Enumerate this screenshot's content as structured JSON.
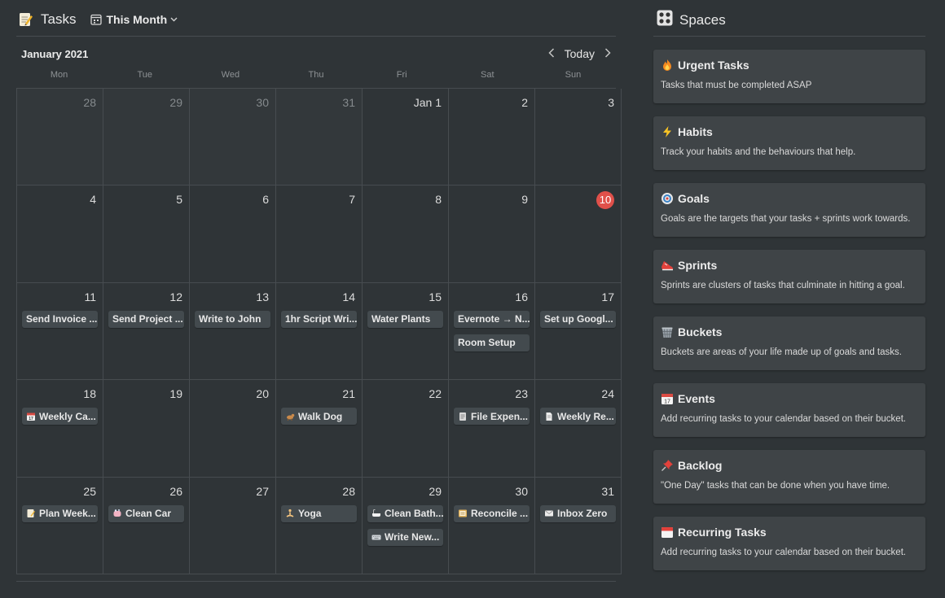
{
  "header": {
    "title": "Tasks",
    "icon": "memo-icon",
    "view_label": "This Month"
  },
  "calendar": {
    "month_title": "January 2021",
    "today_label": "Today",
    "weekdays": [
      "Mon",
      "Tue",
      "Wed",
      "Thu",
      "Fri",
      "Sat",
      "Sun"
    ],
    "today_date": "10",
    "days": [
      {
        "label": "28",
        "muted": true,
        "tasks": []
      },
      {
        "label": "29",
        "muted": true,
        "tasks": []
      },
      {
        "label": "30",
        "muted": true,
        "tasks": []
      },
      {
        "label": "31",
        "muted": true,
        "tasks": []
      },
      {
        "label": "Jan 1",
        "muted": false,
        "tasks": []
      },
      {
        "label": "2",
        "muted": false,
        "tasks": []
      },
      {
        "label": "3",
        "muted": false,
        "tasks": []
      },
      {
        "label": "4",
        "muted": false,
        "tasks": []
      },
      {
        "label": "5",
        "muted": false,
        "tasks": []
      },
      {
        "label": "6",
        "muted": false,
        "tasks": []
      },
      {
        "label": "7",
        "muted": false,
        "tasks": []
      },
      {
        "label": "8",
        "muted": false,
        "tasks": []
      },
      {
        "label": "9",
        "muted": false,
        "tasks": []
      },
      {
        "label": "10",
        "muted": false,
        "today": true,
        "tasks": []
      },
      {
        "label": "11",
        "muted": false,
        "tasks": [
          {
            "text": "Send Invoice ..."
          }
        ]
      },
      {
        "label": "12",
        "muted": false,
        "tasks": [
          {
            "text": "Send Project ..."
          }
        ]
      },
      {
        "label": "13",
        "muted": false,
        "tasks": [
          {
            "text": "Write to John"
          }
        ]
      },
      {
        "label": "14",
        "muted": false,
        "tasks": [
          {
            "text": "1hr Script Wri..."
          }
        ]
      },
      {
        "label": "15",
        "muted": false,
        "tasks": [
          {
            "text": "Water Plants"
          }
        ]
      },
      {
        "label": "16",
        "muted": false,
        "tasks": [
          {
            "text": "Evernote → N..."
          },
          {
            "text": "Room Setup"
          }
        ]
      },
      {
        "label": "17",
        "muted": false,
        "tasks": [
          {
            "text": "Set up Googl..."
          }
        ]
      },
      {
        "label": "18",
        "muted": false,
        "tasks": [
          {
            "text": "Weekly Ca...",
            "icon": "calendar-icon"
          }
        ]
      },
      {
        "label": "19",
        "muted": false,
        "tasks": []
      },
      {
        "label": "20",
        "muted": false,
        "tasks": []
      },
      {
        "label": "21",
        "muted": false,
        "tasks": [
          {
            "text": "Walk Dog",
            "icon": "dog-icon"
          }
        ]
      },
      {
        "label": "22",
        "muted": false,
        "tasks": []
      },
      {
        "label": "23",
        "muted": false,
        "tasks": [
          {
            "text": "File Expen...",
            "icon": "document-icon"
          }
        ]
      },
      {
        "label": "24",
        "muted": false,
        "tasks": [
          {
            "text": "Weekly Re...",
            "icon": "page-icon"
          }
        ]
      },
      {
        "label": "25",
        "muted": false,
        "tasks": [
          {
            "text": "Plan Week...",
            "icon": "memo-icon"
          }
        ]
      },
      {
        "label": "26",
        "muted": false,
        "tasks": [
          {
            "text": "Clean Car",
            "icon": "soap-icon"
          }
        ]
      },
      {
        "label": "27",
        "muted": false,
        "tasks": []
      },
      {
        "label": "28",
        "muted": false,
        "tasks": [
          {
            "text": "Yoga",
            "icon": "yoga-icon"
          }
        ]
      },
      {
        "label": "29",
        "muted": false,
        "tasks": [
          {
            "text": "Clean Bath...",
            "icon": "bathtub-icon"
          },
          {
            "text": "Write New...",
            "icon": "keyboard-icon"
          }
        ]
      },
      {
        "label": "30",
        "muted": false,
        "tasks": [
          {
            "text": "Reconcile ...",
            "icon": "ledger-icon"
          }
        ]
      },
      {
        "label": "31",
        "muted": false,
        "tasks": [
          {
            "text": "Inbox Zero",
            "icon": "envelope-icon"
          }
        ]
      }
    ]
  },
  "spaces": {
    "title": "Spaces",
    "icon": "spaces-grid-icon",
    "cards": [
      {
        "title": "Urgent Tasks",
        "desc": "Tasks that must be completed ASAP",
        "icon": "fire-icon"
      },
      {
        "title": "Habits",
        "desc": "Track your habits and the behaviours that help.",
        "icon": "lightning-icon"
      },
      {
        "title": "Goals",
        "desc": "Goals are the targets that your tasks + sprints work towards.",
        "icon": "target-icon"
      },
      {
        "title": "Sprints",
        "desc": "Sprints are clusters of tasks that culminate in hitting a goal.",
        "icon": "running-shoe-icon"
      },
      {
        "title": "Buckets",
        "desc": "Buckets are areas of your life made up of goals and tasks.",
        "icon": "basket-icon"
      },
      {
        "title": "Events",
        "desc": "Add recurring tasks to your calendar based on their bucket.",
        "icon": "calendar-icon"
      },
      {
        "title": "Backlog",
        "desc": "\"One Day\" tasks that can be done when you have time.",
        "icon": "pushpin-icon"
      },
      {
        "title": "Recurring Tasks",
        "desc": "Add recurring tasks to your calendar based on their bucket.",
        "icon": "tear-off-calendar-icon"
      }
    ]
  },
  "colors": {
    "background": "#2f3437",
    "card": "#3f4447",
    "task_chip": "#434a4e",
    "today_badge": "#e0504a"
  }
}
